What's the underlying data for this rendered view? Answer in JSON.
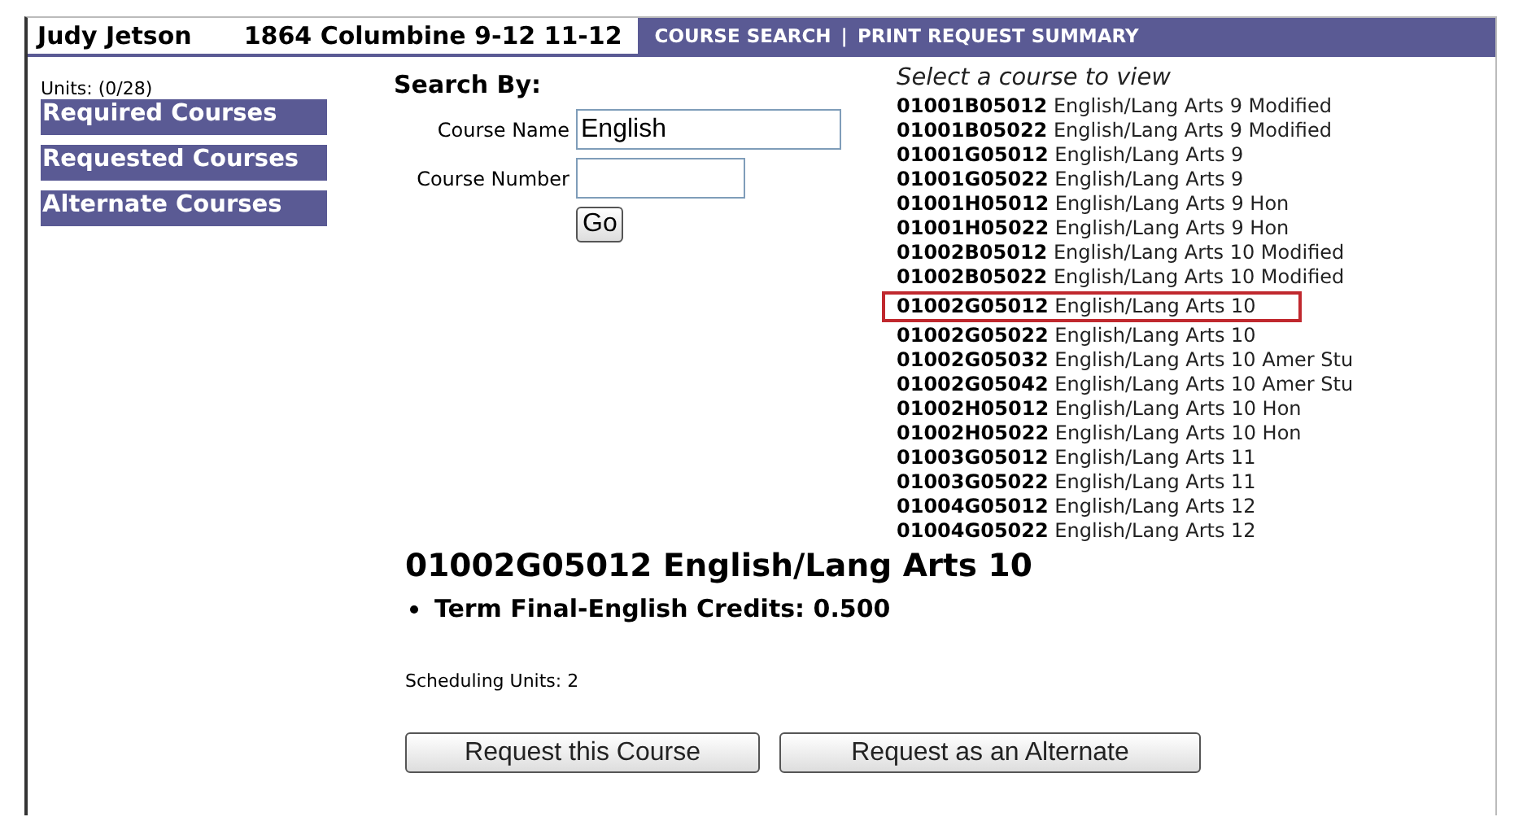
{
  "header": {
    "student": "Judy Jetson",
    "school": "1864 Columbine 9-12 11-12",
    "nav": [
      {
        "label": "COURSE SEARCH"
      },
      {
        "label": "PRINT REQUEST SUMMARY"
      }
    ],
    "separator": "|"
  },
  "sidebar": {
    "units": "Units: (0/28)",
    "items": [
      {
        "label": "Required Courses"
      },
      {
        "label": "Requested Courses"
      },
      {
        "label": "Alternate Courses"
      }
    ]
  },
  "search": {
    "title": "Search By:",
    "fields": [
      {
        "label": "Course Name",
        "value": "English",
        "kind": "wide"
      },
      {
        "label": "Course Number",
        "kind": "narrow"
      }
    ],
    "button": "Go"
  },
  "course_list": {
    "title": "Select a course to view",
    "items": [
      {
        "code": "01001B05012",
        "name": "English/Lang Arts 9 Modified",
        "selected": false
      },
      {
        "code": "01001B05022",
        "name": "English/Lang Arts 9 Modified",
        "selected": false
      },
      {
        "code": "01001G05012",
        "name": "English/Lang Arts 9",
        "selected": false
      },
      {
        "code": "01001G05022",
        "name": "English/Lang Arts 9",
        "selected": false
      },
      {
        "code": "01001H05012",
        "name": "English/Lang Arts 9 Hon",
        "selected": false
      },
      {
        "code": "01001H05022",
        "name": "English/Lang Arts 9 Hon",
        "selected": false
      },
      {
        "code": "01002B05012",
        "name": "English/Lang Arts 10 Modified",
        "selected": false
      },
      {
        "code": "01002B05022",
        "name": "English/Lang Arts 10 Modified",
        "selected": false
      },
      {
        "code": "01002G05012",
        "name": "English/Lang Arts 10",
        "selected": true
      },
      {
        "code": "01002G05022",
        "name": "English/Lang Arts 10",
        "selected": false
      },
      {
        "code": "01002G05032",
        "name": "English/Lang Arts 10 Amer Stu",
        "selected": false
      },
      {
        "code": "01002G05042",
        "name": "English/Lang Arts 10 Amer Stu",
        "selected": false
      },
      {
        "code": "01002H05012",
        "name": "English/Lang Arts 10 Hon",
        "selected": false
      },
      {
        "code": "01002H05022",
        "name": "English/Lang Arts 10 Hon",
        "selected": false
      },
      {
        "code": "01003G05012",
        "name": "English/Lang Arts 11",
        "selected": false
      },
      {
        "code": "01003G05022",
        "name": "English/Lang Arts 11",
        "selected": false
      },
      {
        "code": "01004G05012",
        "name": "English/Lang Arts 12",
        "selected": false
      },
      {
        "code": "01004G05022",
        "name": "English/Lang Arts 12",
        "selected": false
      }
    ]
  },
  "detail": {
    "title": "01002G05012 English/Lang Arts 10",
    "bullets": [
      "Term Final-English Credits: 0.500"
    ],
    "units": "Scheduling Units: 2",
    "buttons": [
      {
        "label": "Request this Course"
      },
      {
        "label": "Request as an Alternate"
      }
    ]
  }
}
